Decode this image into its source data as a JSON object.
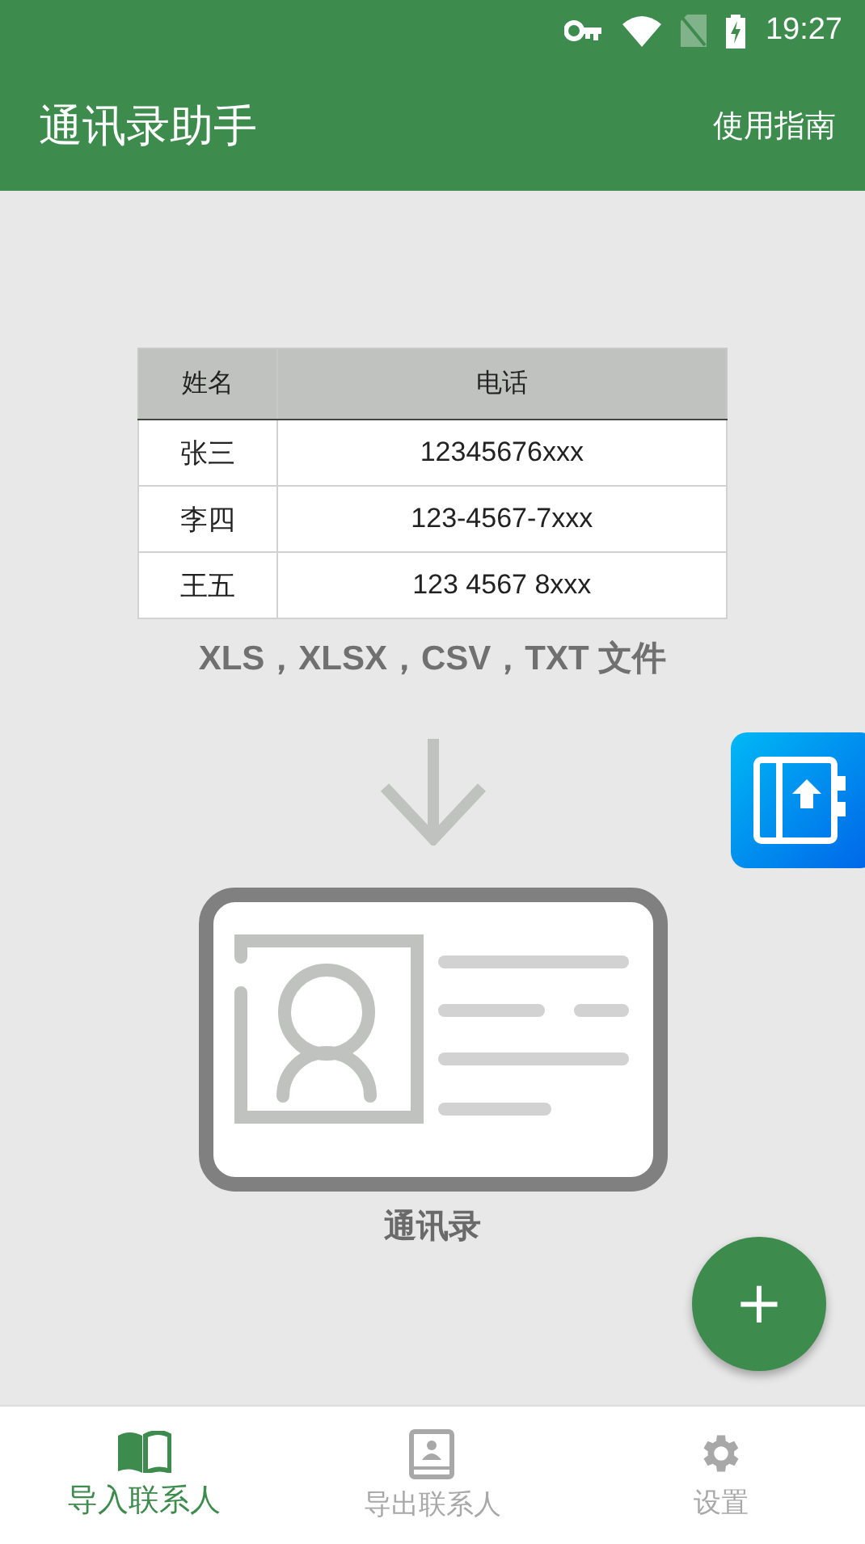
{
  "status_bar": {
    "time": "19:27"
  },
  "app_bar": {
    "title": "通讯录助手",
    "action": "使用指南"
  },
  "sample_table": {
    "columns": [
      "姓名",
      "电话"
    ],
    "rows": [
      [
        "张三",
        "12345676xxx"
      ],
      [
        "李四",
        "123-4567-7xxx"
      ],
      [
        "王五",
        "123 4567 8xxx"
      ]
    ]
  },
  "formats_caption": "XLS，XLSX，CSV，TXT 文件",
  "target_caption": "通讯录",
  "fab": {
    "label": "+"
  },
  "bottom_nav": [
    {
      "label": "导入联系人",
      "selected": true
    },
    {
      "label": "导出联系人",
      "selected": false
    },
    {
      "label": "设置",
      "selected": false
    }
  ]
}
